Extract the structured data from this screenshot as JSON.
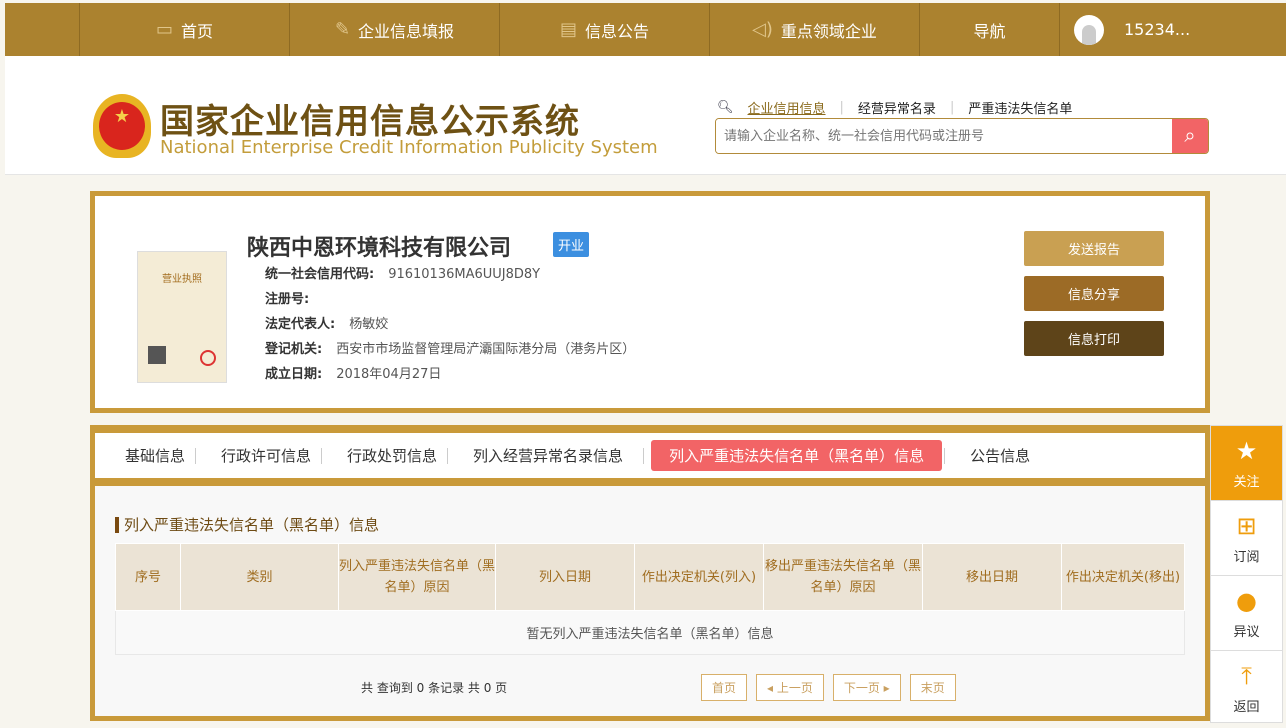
{
  "nav": {
    "items": [
      {
        "label": "首页",
        "icon": "monitor-icon"
      },
      {
        "label": "企业信息填报",
        "icon": "pen-icon"
      },
      {
        "label": "信息公告",
        "icon": "document-icon"
      },
      {
        "label": "重点领域企业",
        "icon": "speaker-icon"
      },
      {
        "label": "导航"
      }
    ],
    "user": "15234..."
  },
  "header": {
    "title_cn": "国家企业信用信息公示系统",
    "title_en": "National Enterprise Credit Information Publicity System",
    "search_links": [
      "企业信用信息",
      "经营异常名录",
      "严重违法失信名单"
    ],
    "search_placeholder": "请输入企业名称、统一社会信用代码或注册号"
  },
  "company": {
    "name": "陕西中恩环境科技有限公司",
    "status": "开业",
    "license_label": "营业执照",
    "fields": [
      {
        "label": "统一社会信用代码:",
        "value": "91610136MA6UUJ8D8Y"
      },
      {
        "label": "注册号:",
        "value": ""
      },
      {
        "label": "法定代表人:",
        "value": "杨敏姣"
      },
      {
        "label": "登记机关:",
        "value": "西安市市场监督管理局浐灞国际港分局（港务片区）"
      },
      {
        "label": "成立日期:",
        "value": "2018年04月27日"
      }
    ],
    "buttons": [
      "发送报告",
      "信息分享",
      "信息打印"
    ]
  },
  "tabs": [
    "基础信息",
    "行政许可信息",
    "行政处罚信息",
    "列入经营异常名录信息",
    "列入严重违法失信名单（黑名单）信息",
    "公告信息"
  ],
  "section": {
    "title": "列入严重违法失信名单（黑名单）信息",
    "columns": [
      "序号",
      "类别",
      "列入严重违法失信名单（黑名单）原因",
      "列入日期",
      "作出决定机关(列入)",
      "移出严重违法失信名单（黑名单）原因",
      "移出日期",
      "作出决定机关(移出)"
    ],
    "empty": "暂无列入严重违法失信名单（黑名单）信息",
    "count": "共 查询到 0 条记录 共 0 页",
    "pager": [
      "首页",
      "◂ 上一页",
      "下一页 ▸",
      "末页"
    ]
  },
  "side": [
    {
      "label": "关注",
      "icon": "star-icon"
    },
    {
      "label": "订阅",
      "icon": "bookmark-plus-icon"
    },
    {
      "label": "异议",
      "icon": "chat-icon"
    },
    {
      "label": "返回",
      "icon": "back-to-top-icon"
    }
  ]
}
